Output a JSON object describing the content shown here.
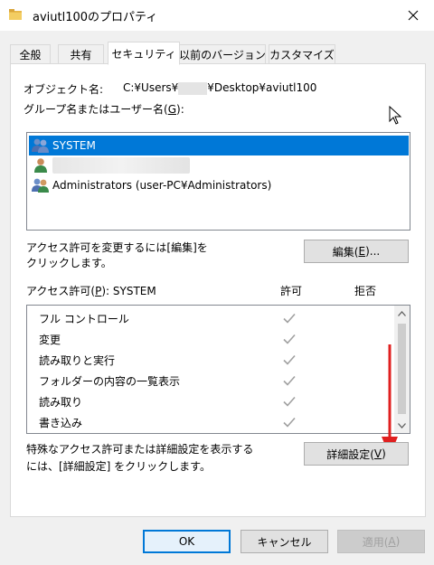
{
  "window": {
    "title": "aviutl100のプロパティ"
  },
  "tabs": [
    {
      "label": "全般"
    },
    {
      "label": "共有"
    },
    {
      "label": "セキュリティ"
    },
    {
      "label": "以前のバージョン"
    },
    {
      "label": "カスタマイズ"
    }
  ],
  "security": {
    "object_label": "オブジェクト名:",
    "object_path_prefix": "C:¥Users¥",
    "object_path_suffix": "¥Desktop¥aviutl100",
    "group_label_pre": "グループ名またはユーザー名(",
    "group_label_key": "G",
    "group_label_post": "):",
    "users": [
      {
        "name": "SYSTEM"
      },
      {
        "name": ""
      },
      {
        "name": "Administrators (user-PC¥Administrators)"
      }
    ],
    "edit_hint_line1": "アクセス許可を変更するには[編集]を",
    "edit_hint_line2": "クリックします。",
    "edit_btn_pre": "編集(",
    "edit_btn_key": "E",
    "edit_btn_post": ")...",
    "perm_label_pre": "アクセス許可(",
    "perm_label_key": "P",
    "perm_label_post": "): SYSTEM",
    "col_allow": "許可",
    "col_deny": "拒否",
    "permissions": [
      {
        "name": "フル コントロール",
        "allow": true,
        "deny": false
      },
      {
        "name": "変更",
        "allow": true,
        "deny": false
      },
      {
        "name": "読み取りと実行",
        "allow": true,
        "deny": false
      },
      {
        "name": "フォルダーの内容の一覧表示",
        "allow": true,
        "deny": false
      },
      {
        "name": "読み取り",
        "allow": true,
        "deny": false
      },
      {
        "name": "書き込み",
        "allow": true,
        "deny": false
      }
    ],
    "advanced_hint_line1": "特殊なアクセス許可または詳細設定を表示する",
    "advanced_hint_line2": "には、[詳細設定] をクリックします。",
    "advanced_btn_pre": "詳細設定(",
    "advanced_btn_key": "V",
    "advanced_btn_post": ")"
  },
  "footer": {
    "ok": "OK",
    "cancel": "キャンセル",
    "apply_pre": "適用(",
    "apply_key": "A",
    "apply_post": ")"
  },
  "colors": {
    "selection": "#0078d7",
    "annotation_arrow": "#e02020",
    "check_disabled": "#a0a0a0"
  },
  "icons": {
    "title": "folder-icon",
    "close": "close-icon",
    "users": [
      "users-group-icon",
      "user-icon",
      "users-group-icon"
    ],
    "check": "checkmark-icon",
    "annotation": "red-arrow-annotation"
  }
}
